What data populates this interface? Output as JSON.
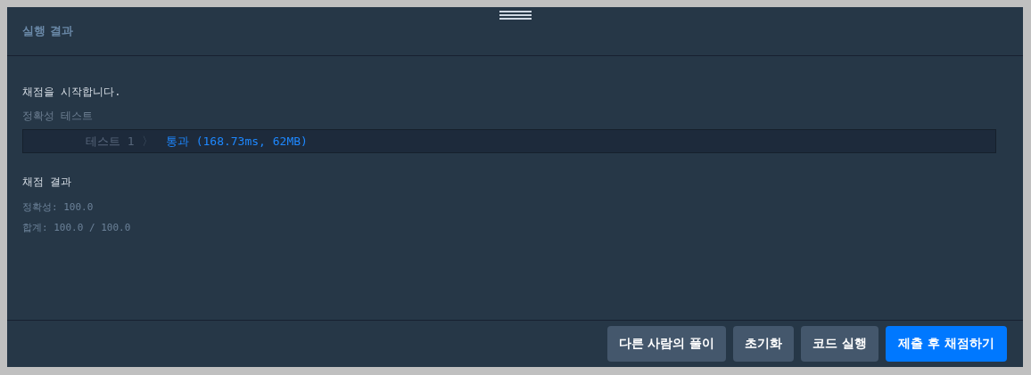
{
  "panel": {
    "title": "실행 결과"
  },
  "output": {
    "start_message": "채점을 시작합니다.",
    "section_label": "정확성  테스트",
    "tests": [
      {
        "name": "테스트 1",
        "separator": "〉",
        "result": "통과",
        "detail": "(168.73ms, 62MB)",
        "passed": true
      }
    ],
    "summary_title": "채점 결과",
    "summary_lines": [
      "정확성: 100.0",
      "합계: 100.0 / 100.0"
    ]
  },
  "buttons": [
    {
      "label": "다른 사람의 풀이",
      "kind": "secondary"
    },
    {
      "label": "초기화",
      "kind": "secondary"
    },
    {
      "label": "코드 실행",
      "kind": "secondary"
    },
    {
      "label": "제출 후 채점하기",
      "kind": "primary"
    }
  ]
}
